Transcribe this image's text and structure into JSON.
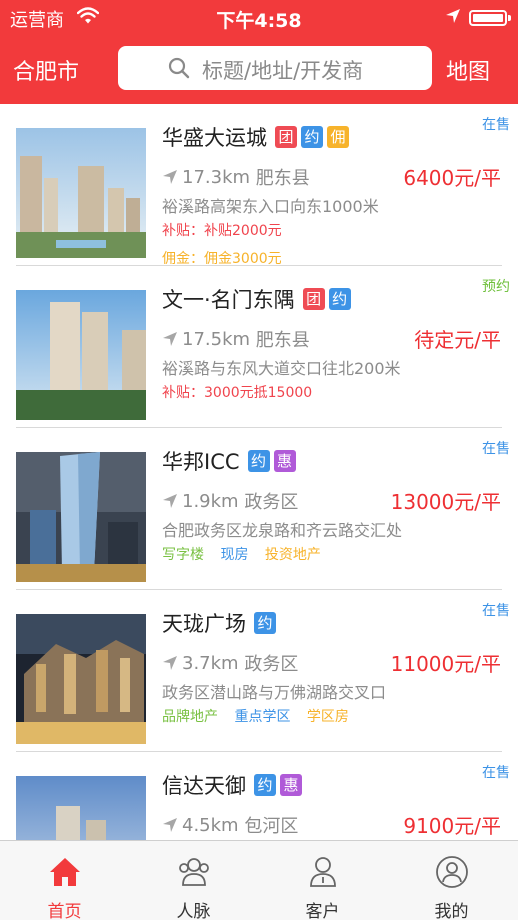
{
  "status_bar": {
    "carrier": "运营商",
    "time": "下午4:58",
    "icons": [
      "wifi-icon",
      "location-arrow-icon",
      "battery-icon"
    ]
  },
  "header": {
    "city": "合肥市",
    "search_placeholder": "标题/地址/开发商",
    "map_label": "地图"
  },
  "colors": {
    "brand": "#f23a3c",
    "price": "#ee2f33",
    "tag_tuan": "#ef4b54",
    "tag_yue": "#3d93e6",
    "tag_yong": "#f7b32b",
    "tag_hui": "#b05ad8",
    "status_onsale": "#3d93e6",
    "status_reserve": "#6dbf3a"
  },
  "listings": [
    {
      "name": "华盛大运城",
      "tags": [
        "团",
        "约",
        "佣"
      ],
      "status": "在售",
      "distance": "17.3km",
      "district": "肥东县",
      "price": "6400元/平",
      "address": "裕溪路高架东入口向东1000米",
      "line1": "补贴：补贴2000元",
      "line2": "佣金：佣金3000元",
      "keywords": []
    },
    {
      "name": "文一·名门东隅",
      "tags": [
        "团",
        "约"
      ],
      "status": "预约",
      "distance": "17.5km",
      "district": "肥东县",
      "price": "待定元/平",
      "address": "裕溪路与东风大道交口往北200米",
      "line1": "补贴：3000元抵15000",
      "line2": "",
      "keywords": []
    },
    {
      "name": "华邦ICC",
      "tags": [
        "约",
        "惠"
      ],
      "status": "在售",
      "distance": "1.9km",
      "district": "政务区",
      "price": "13000元/平",
      "address": "合肥政务区龙泉路和齐云路交汇处",
      "line1": "",
      "line2": "",
      "keywords": [
        "写字楼",
        "现房",
        "投资地产"
      ]
    },
    {
      "name": "天珑广场",
      "tags": [
        "约"
      ],
      "status": "在售",
      "distance": "3.7km",
      "district": "政务区",
      "price": "11000元/平",
      "address": "政务区潜山路与万佛湖路交叉口",
      "line1": "",
      "line2": "",
      "keywords": [
        "品牌地产",
        "重点学区",
        "学区房"
      ]
    },
    {
      "name": "信达天御",
      "tags": [
        "约",
        "惠"
      ],
      "status": "在售",
      "distance": "4.5km",
      "district": "包河区",
      "price": "9100元/平",
      "address": "",
      "line1": "",
      "line2": "",
      "keywords": []
    }
  ],
  "keyword_colors": [
    "#7ac143",
    "#3d93e6",
    "#f7b32b"
  ],
  "tabbar": {
    "items": [
      {
        "label": "首页",
        "icon": "home-icon",
        "active": true
      },
      {
        "label": "人脉",
        "icon": "contacts-icon",
        "active": false
      },
      {
        "label": "客户",
        "icon": "customer-icon",
        "active": false
      },
      {
        "label": "我的",
        "icon": "profile-icon",
        "active": false
      }
    ]
  }
}
